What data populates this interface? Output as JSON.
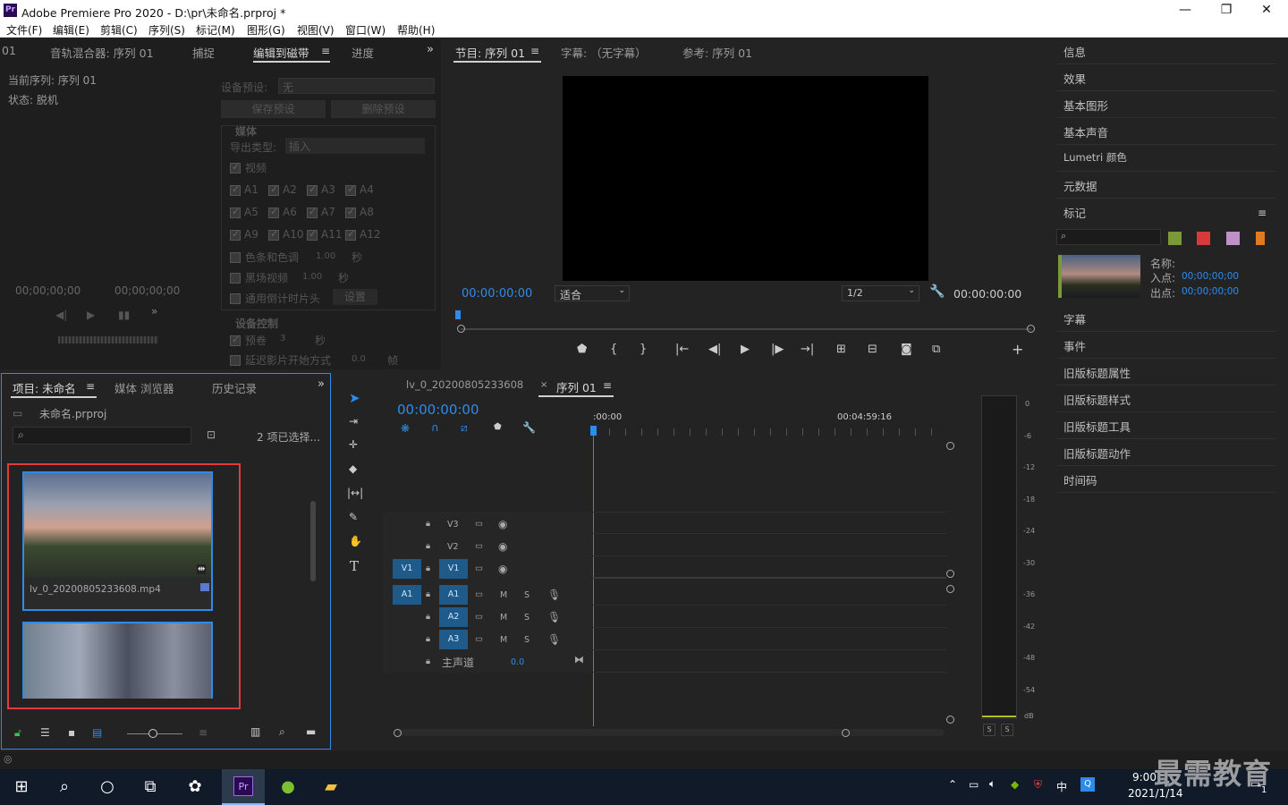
{
  "app": {
    "title": "Adobe Premiere Pro 2020 - D:\\pr\\未命名.prproj *",
    "logo": "Pr"
  },
  "menu": [
    "文件(F)",
    "编辑(E)",
    "剪辑(C)",
    "序列(S)",
    "标记(M)",
    "图形(G)",
    "视图(V)",
    "窗口(W)",
    "帮助(H)"
  ],
  "window_buttons": {
    "minimize": "—",
    "maximize": "❐",
    "close": "✕"
  },
  "source_panel": {
    "tabs": [
      "01",
      "音轨混合器: 序列 01",
      "捕捉",
      "编辑到磁带",
      "进度"
    ],
    "active_tab": "编辑到磁带",
    "current_sequence": "当前序列: 序列 01",
    "status": "状态: 脱机",
    "tc_left": "00;00;00;00",
    "tc_right": "00;00;00;00",
    "device_preset_label": "设备预设:",
    "device_preset_value": "无",
    "save_preset": "保存预设",
    "delete_preset": "删除预设",
    "media_header": "媒体",
    "export_type_label": "导出类型:",
    "export_type_value": "插入",
    "video_label": "视频",
    "audio_tracks": [
      "A1",
      "A2",
      "A3",
      "A4",
      "A5",
      "A6",
      "A7",
      "A8",
      "A9",
      "A10",
      "A11",
      "A12"
    ],
    "bars_tone": "色条和色调",
    "bars_value": "1.00",
    "black_video": "黑场视频",
    "black_value": "1.00",
    "countdown": "通用倒计时片头",
    "settings": "设置",
    "sec": "秒",
    "device_control": "设备控制",
    "preroll": "预卷",
    "preroll_value": "3",
    "delay_start": "延迟影片开始方式",
    "delay_value": "0.0",
    "frames": "帧"
  },
  "program_monitor": {
    "tabs": [
      "节目: 序列 01",
      "字幕: （无字幕）",
      "参考: 序列 01"
    ],
    "tc_current": "00:00:00:00",
    "fit": "适合",
    "resolution": "1/2",
    "tc_duration": "00:00:00:00"
  },
  "project_panel": {
    "tabs": [
      "项目: 未命名",
      "媒体 浏览器",
      "历史记录"
    ],
    "project_file": "未命名.prproj",
    "selection": "2 项已选择...",
    "clips": [
      {
        "name": "lv_0_20200805233608.mp4"
      },
      {
        "name": ""
      }
    ]
  },
  "timeline": {
    "tabs": [
      "lv_0_20200805233608",
      "序列 01"
    ],
    "timecode": "00:00:00:00",
    "ruler_start": ":00:00",
    "ruler_mid": "00:04:59:16",
    "video_tracks": [
      "V3",
      "V2",
      "V1"
    ],
    "audio_tracks": [
      "A1",
      "A2",
      "A3"
    ],
    "source_v": "V1",
    "source_a": "A1",
    "master": "主声道",
    "master_value": "0.0",
    "mute": "M",
    "solo": "S"
  },
  "meter": {
    "labels": [
      "0",
      "-6",
      "-12",
      "-18",
      "-24",
      "-30",
      "-36",
      "-42",
      "-48",
      "-54",
      "dB"
    ],
    "solo_buttons": [
      "S",
      "S"
    ]
  },
  "right_panel": {
    "items_top": [
      "信息",
      "效果",
      "基本图形",
      "基本声音",
      "Lumetri 颜色",
      "元数据"
    ],
    "markers_title": "标记",
    "marker_colors": [
      "#7a9a3a",
      "#d83a3a",
      "#c090c8",
      "#e07a20"
    ],
    "marker_name_label": "名称:",
    "marker_in_label": "入点:",
    "marker_in": "00;00;00;00",
    "marker_out_label": "出点:",
    "marker_out": "00;00;00;00",
    "items_bottom": [
      "字幕",
      "事件",
      "旧版标题属性",
      "旧版标题样式",
      "旧版标题工具",
      "旧版标题动作",
      "时间码"
    ]
  },
  "taskbar": {
    "time": "9:00",
    "date": "2021/1/14",
    "ime": "中",
    "watermark": "最需教育",
    "notification_count": "1"
  }
}
